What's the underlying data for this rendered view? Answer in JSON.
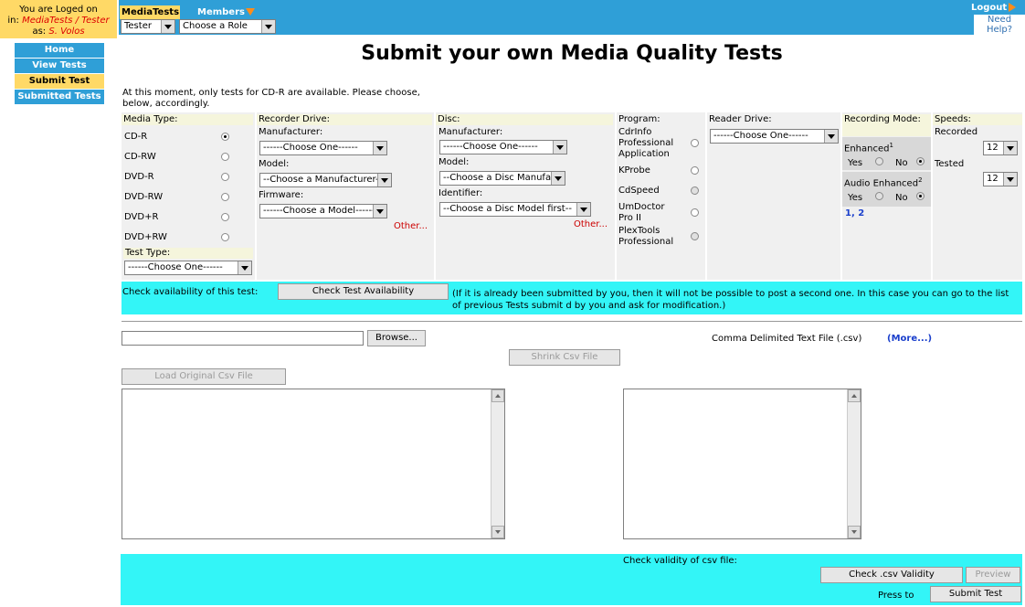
{
  "login": {
    "line1": "You are Loged on",
    "line2": "in:",
    "path": "MediaTests / Tester",
    "line3": "as:",
    "user": "S. Volos"
  },
  "topnav": {
    "media_tab": "MediaTests",
    "members_tab": "Members",
    "role_select": "Tester",
    "choose_role": "Choose a Role",
    "logout": "Logout",
    "need_help": "Need Help?"
  },
  "sidebar": {
    "items": [
      {
        "label": "Home"
      },
      {
        "label": "View Tests"
      },
      {
        "label": "Submit Test"
      },
      {
        "label": "Submitted Tests"
      }
    ]
  },
  "page": {
    "title": "Submit your own Media Quality Tests",
    "intro": "At this moment, only tests for CD-R are available. Please choose, below, accordingly."
  },
  "form": {
    "media_type": {
      "label": "Media Type:",
      "options": [
        "CD-R",
        "CD-RW",
        "DVD-R",
        "DVD-RW",
        "DVD+R",
        "DVD+RW"
      ]
    },
    "test_type": {
      "label": "Test Type:",
      "value": "------Choose One------"
    },
    "recorder": {
      "label": "Recorder Drive:",
      "manufacturer_label": "Manufacturer:",
      "manufacturer": "------Choose One------",
      "model_label": "Model:",
      "model": "--Choose a Manufacturer--",
      "firmware_label": "Firmware:",
      "firmware": "------Choose a Model------",
      "other": "Other..."
    },
    "disc": {
      "label": "Disc:",
      "manufacturer_label": "Manufacturer:",
      "manufacturer": "------Choose One------",
      "model_label": "Model:",
      "model": "--Choose a Disc Manufacturer--",
      "identifier_label": "Identifier:",
      "identifier": "--Choose a Disc Model first--",
      "other": "Other..."
    },
    "program": {
      "label": "Program:",
      "options": [
        "CdrInfo Professional Application",
        "KProbe",
        "CdSpeed",
        "UmDoctor Pro II",
        "PlexTools Professional"
      ]
    },
    "reader": {
      "label": "Reader Drive:",
      "value": "------Choose One------"
    },
    "recording": {
      "label": "Recording Mode:",
      "enhanced": "Enhanced",
      "enhanced_sup": "1",
      "audio": "Audio Enhanced",
      "audio_sup": "2",
      "yes": "Yes",
      "no": "No",
      "notes": "1, 2"
    },
    "speeds": {
      "label": "Speeds:",
      "recorded_label": "Recorded",
      "recorded": "12",
      "tested_label": "Tested",
      "tested": "12"
    }
  },
  "availability": {
    "prefix": "Check availability of this test:",
    "button": "Check Test Availability",
    "note": "(If it is already been submitted by you, then it will not be possible to post a second one. In this case you can go to the list of previous Tests submit d by you and ask for modification.)"
  },
  "upload": {
    "browse": "Browse...",
    "csv_label": "Comma Delimited Text File (.csv)",
    "more": "(More...)",
    "shrink": "Shrink Csv File",
    "load": "Load Original Csv File"
  },
  "footer": {
    "validity_label": "Check validity of csv file:",
    "check": "Check .csv Validity",
    "preview": "Preview",
    "press_to": "Press to",
    "submit": "Submit Test"
  }
}
